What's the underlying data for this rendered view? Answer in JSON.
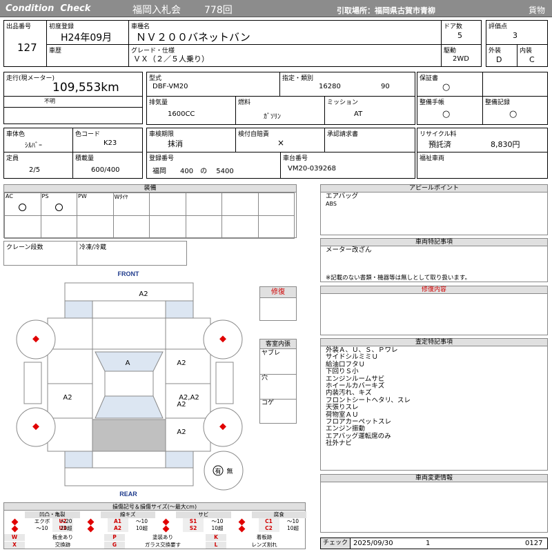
{
  "header": {
    "brand": "Condition  Check",
    "auction": "福岡入札会",
    "lot": "778回",
    "pickup": "引取場所：福岡県古賀市青柳",
    "category": "貨物"
  },
  "vehicle": {
    "lot_no_label": "出品番号",
    "lot_no": "127",
    "first_reg_label": "初度登録",
    "first_reg": "H24年09月",
    "name_label": "車種名",
    "name": "ＮＶ２００バネットバン",
    "doors_label": "ドア数",
    "doors": "5",
    "score_label": "評価点",
    "score": "3",
    "history_label": "車歴",
    "grade_label": "グレード・仕様",
    "grade": "ＶＸ（２／５人乗り）",
    "drive_label": "駆動",
    "drive": "2WD",
    "ext_label": "外装",
    "ext": "D",
    "int_label": "内装",
    "int": "C",
    "mileage_label": "走行(現メーター)",
    "mileage": "109,553km",
    "mileage_note": "不明",
    "model_label": "型式",
    "model": "DBF-VM20",
    "designation_label": "指定・類別",
    "designation": "16280",
    "category_no": "90",
    "warranty_label": "保証書",
    "warranty": "○",
    "displacement_label": "排気量",
    "displacement": "1600CC",
    "fuel_label": "燃料",
    "fuel": "ｶﾞｿﾘﾝ",
    "mission_label": "ミッション",
    "mission": "AT",
    "manual_label": "整備手帳",
    "manual": "○",
    "record_label": "整備記録",
    "record": "○",
    "color_label": "車体色",
    "color": "ｼﾙﾊﾞｰ",
    "color_code_label": "色コード",
    "color_code": "K23",
    "inspection_label": "車検期限",
    "inspection": "抹消",
    "insurance_label": "検付自賠責",
    "insurance": "×",
    "approval_label": "承認請求書",
    "recycle_label": "リサイクル料",
    "recycle_status": "預託済",
    "recycle_fee": "8,830円",
    "capacity_label": "定員",
    "capacity": "2/5",
    "load_label": "積載量",
    "load": "600/400",
    "plate_label": "登録番号",
    "plate": "福岡　　400　の　 5400",
    "chassis_label": "車台番号",
    "chassis": "VM20-039268",
    "welfare_label": "福祉車両"
  },
  "equipment": {
    "title": "装備",
    "items": [
      "AC",
      "PS",
      "PW",
      "Wﾀｲﾔ"
    ],
    "crane_label": "クレーン段数",
    "fridge_label": "冷凍/冷蔵"
  },
  "appeal": {
    "title": "アピールポイント",
    "lines": [
      "エアバッグ",
      "ABS"
    ]
  },
  "special": {
    "title": "車両特記事項",
    "line1": "メーター改ざん",
    "note": "※記載のない書類・機器等は無しとして取り扱います。"
  },
  "repair": {
    "title": "修復内容",
    "side_label": "修復"
  },
  "cabin": {
    "title": "客室内張",
    "items": [
      "ヤブレ",
      "穴",
      "コゲ"
    ]
  },
  "inspection_notes": {
    "title": "査定特記事項",
    "lines": [
      "外装Ａ、Ｕ、Ｓ、Ｐワレ",
      "サイドシルミミＵ",
      "給油口フタＵ",
      "下回りＳ小",
      "エンジンルームサビ",
      "ホイールカバーキズ",
      "内装汚れ、キズ",
      "フロントシートヘタリ、スレ",
      "天張りスレ",
      "荷物室ＡＵ",
      "フロアカーペットスレ",
      "エンジン振動",
      "エアバッグ運転席のみ",
      "社外ナビ"
    ]
  },
  "change": {
    "title": "車両変更情報"
  },
  "diagram": {
    "front": "FRONT",
    "rear": "REAR",
    "marks": {
      "hood": "A2",
      "roof": "A",
      "right_front": "A2",
      "left_rear": "A2",
      "right_rear": "A2,A2\nA2",
      "right_rear2": "A2"
    },
    "nav": "有",
    "nav_none": "無"
  },
  "legend": {
    "title": "損傷記号＆損傷サイズ(〜最大cm)",
    "groups": [
      {
        "name": "凹凸・亀裂",
        "c1": "エクボ",
        "c2": "U2",
        "c3": "〜20",
        "c4": "〜10",
        "c5": "U3",
        "c6": "20超"
      },
      {
        "name": "線キズ",
        "c2": "A1",
        "c3": "〜10",
        "c5": "A2",
        "c6": "10超"
      },
      {
        "name": "サビ",
        "c2": "S1",
        "c3": "〜10",
        "c5": "S2",
        "c6": "10超"
      },
      {
        "name": "腐食",
        "c2": "C1",
        "c3": "〜10",
        "c5": "C2",
        "c6": "10超"
      }
    ],
    "rows": [
      {
        "k1": "W",
        "v1": "板金あり",
        "k2": "P",
        "v2": "塗装あり",
        "k3": "K",
        "v3": "着板跡"
      },
      {
        "k1": "X",
        "v1": "交換跡",
        "k2": "G",
        "v2": "ガラス交換要す",
        "k3": "L",
        "v3": "レンズ割れ"
      }
    ]
  },
  "check": {
    "label": "チェック",
    "date": "2025/09/30",
    "n": "1",
    "id": "0127"
  }
}
